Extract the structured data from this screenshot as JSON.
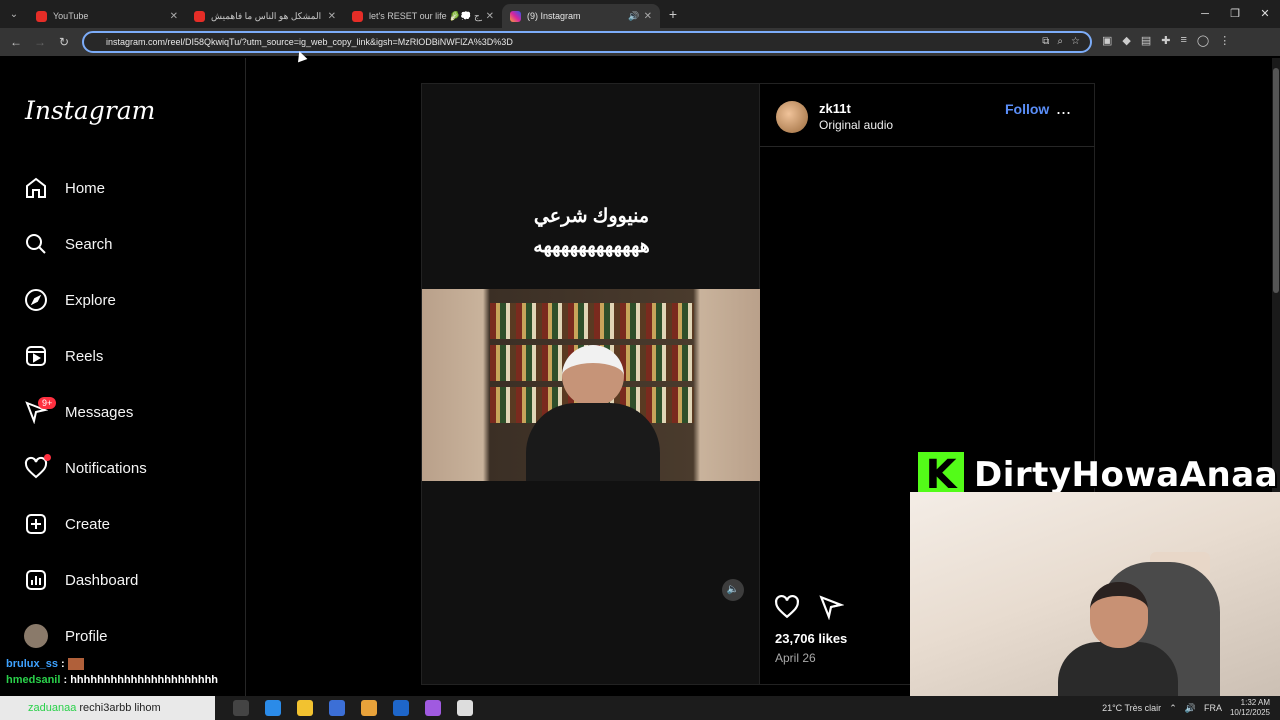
{
  "browser": {
    "tabs": [
      {
        "title": "YouTube",
        "icon": "youtube-icon"
      },
      {
        "title": "المشكل هو الناس ما فاهميش :(",
        "icon": "youtube-icon"
      },
      {
        "title": "let's RESET our life 🥬💭 البرج",
        "icon": "youtube-icon"
      },
      {
        "title": "(9) Instagram",
        "icon": "instagram-icon"
      }
    ],
    "url": "instagram.com/reel/DI58QkwiqTu/?utm_source=ig_web_copy_link&igsh=MzRlODBiNWFlZA%3D%3D"
  },
  "sidebar": {
    "logo": "Instagram",
    "items": [
      {
        "label": "Home",
        "icon": "home-icon"
      },
      {
        "label": "Search",
        "icon": "search-icon"
      },
      {
        "label": "Explore",
        "icon": "compass-icon"
      },
      {
        "label": "Reels",
        "icon": "reels-icon"
      },
      {
        "label": "Messages",
        "icon": "messenger-icon",
        "badge": "9+"
      },
      {
        "label": "Notifications",
        "icon": "heart-icon"
      },
      {
        "label": "Create",
        "icon": "plus-square-icon"
      },
      {
        "label": "Dashboard",
        "icon": "dashboard-icon"
      },
      {
        "label": "Profile",
        "icon": "avatar"
      }
    ]
  },
  "reel": {
    "caption_line1": "منيووك شرعي",
    "caption_line2": "ههههههههههههه",
    "username": "zk11t",
    "audio": "Original audio",
    "follow_label": "Follow",
    "more_label": "...",
    "likes": "23,706 likes",
    "date": "April 26"
  },
  "stream_overlay": {
    "brand_letter": "K",
    "channel_name": "DirtyHowaAnaa",
    "accent": "#53fc18"
  },
  "chat": [
    {
      "user": "brulux_ss",
      "text": ""
    },
    {
      "user": "hmedsanil",
      "text": "hhhhhhhhhhhhhhhhhhhhhh"
    },
    {
      "user": "zaduanaa",
      "text": "rechi3arbb lihom"
    }
  ],
  "taskbar": {
    "weather": "21°C  Très clair",
    "lang": "FRA",
    "time": "1:32 AM",
    "date": "10/12/2025"
  }
}
